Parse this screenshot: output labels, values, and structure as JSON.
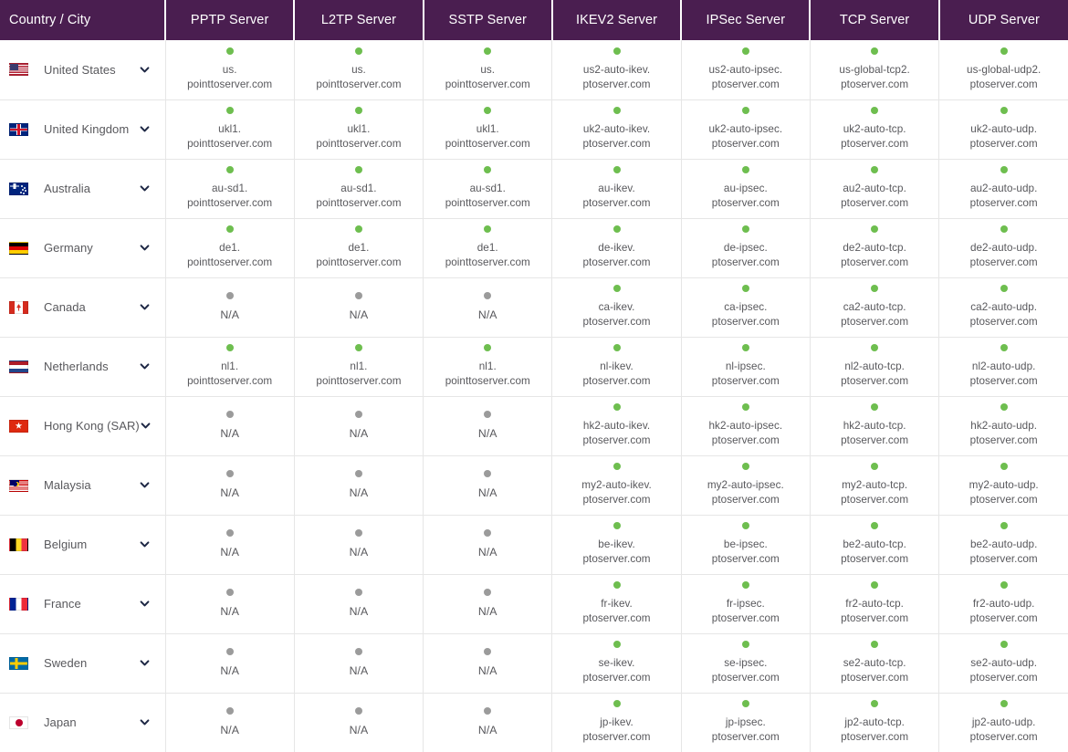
{
  "table": {
    "columns": [
      {
        "key": "country",
        "label": "Country / City"
      },
      {
        "key": "pptp",
        "label": "PPTP Server"
      },
      {
        "key": "l2tp",
        "label": "L2TP Server"
      },
      {
        "key": "sstp",
        "label": "SSTP Server"
      },
      {
        "key": "ikev2",
        "label": "IKEV2 Server"
      },
      {
        "key": "ipsec",
        "label": "IPSec Server"
      },
      {
        "key": "tcp",
        "label": "TCP Server"
      },
      {
        "key": "udp",
        "label": "UDP Server"
      }
    ],
    "na_label": "N/A",
    "expand_icon": "chevron-down-icon",
    "colors": {
      "header_bg": "#4A1E50",
      "header_text": "#ffffff",
      "status_online": "#6EBE4F",
      "status_offline": "#9b9b9b",
      "cell_text": "#58585c",
      "row_border": "#e6e6e6",
      "page_bg": "#ffffff"
    },
    "rows": [
      {
        "country": "United States",
        "flag": "flag-united-states",
        "cells": [
          {
            "status": "online",
            "line1": "us.",
            "line2": "pointtoserver.com"
          },
          {
            "status": "online",
            "line1": "us.",
            "line2": "pointtoserver.com"
          },
          {
            "status": "online",
            "line1": "us.",
            "line2": "pointtoserver.com"
          },
          {
            "status": "online",
            "line1": "us2-auto-ikev.",
            "line2": "ptoserver.com"
          },
          {
            "status": "online",
            "line1": "us2-auto-ipsec.",
            "line2": "ptoserver.com"
          },
          {
            "status": "online",
            "line1": "us-global-tcp2.",
            "line2": "ptoserver.com"
          },
          {
            "status": "online",
            "line1": "us-global-udp2.",
            "line2": "ptoserver.com"
          }
        ]
      },
      {
        "country": "United Kingdom",
        "flag": "flag-united-kingdom",
        "cells": [
          {
            "status": "online",
            "line1": "ukl1.",
            "line2": "pointtoserver.com"
          },
          {
            "status": "online",
            "line1": "ukl1.",
            "line2": "pointtoserver.com"
          },
          {
            "status": "online",
            "line1": "ukl1.",
            "line2": "pointtoserver.com"
          },
          {
            "status": "online",
            "line1": "uk2-auto-ikev.",
            "line2": "ptoserver.com"
          },
          {
            "status": "online",
            "line1": "uk2-auto-ipsec.",
            "line2": "ptoserver.com"
          },
          {
            "status": "online",
            "line1": "uk2-auto-tcp.",
            "line2": "ptoserver.com"
          },
          {
            "status": "online",
            "line1": "uk2-auto-udp.",
            "line2": "ptoserver.com"
          }
        ]
      },
      {
        "country": "Australia",
        "flag": "flag-australia",
        "cells": [
          {
            "status": "online",
            "line1": "au-sd1.",
            "line2": "pointtoserver.com"
          },
          {
            "status": "online",
            "line1": "au-sd1.",
            "line2": "pointtoserver.com"
          },
          {
            "status": "online",
            "line1": "au-sd1.",
            "line2": "pointtoserver.com"
          },
          {
            "status": "online",
            "line1": "au-ikev.",
            "line2": "ptoserver.com"
          },
          {
            "status": "online",
            "line1": "au-ipsec.",
            "line2": "ptoserver.com"
          },
          {
            "status": "online",
            "line1": "au2-auto-tcp.",
            "line2": "ptoserver.com"
          },
          {
            "status": "online",
            "line1": "au2-auto-udp.",
            "line2": "ptoserver.com"
          }
        ]
      },
      {
        "country": "Germany",
        "flag": "flag-germany",
        "cells": [
          {
            "status": "online",
            "line1": "de1.",
            "line2": "pointtoserver.com"
          },
          {
            "status": "online",
            "line1": "de1.",
            "line2": "pointtoserver.com"
          },
          {
            "status": "online",
            "line1": "de1.",
            "line2": "pointtoserver.com"
          },
          {
            "status": "online",
            "line1": "de-ikev.",
            "line2": "ptoserver.com"
          },
          {
            "status": "online",
            "line1": "de-ipsec.",
            "line2": "ptoserver.com"
          },
          {
            "status": "online",
            "line1": "de2-auto-tcp.",
            "line2": "ptoserver.com"
          },
          {
            "status": "online",
            "line1": "de2-auto-udp.",
            "line2": "ptoserver.com"
          }
        ]
      },
      {
        "country": "Canada",
        "flag": "flag-canada",
        "cells": [
          {
            "status": "offline",
            "line1": "N/A",
            "line2": ""
          },
          {
            "status": "offline",
            "line1": "N/A",
            "line2": ""
          },
          {
            "status": "offline",
            "line1": "N/A",
            "line2": ""
          },
          {
            "status": "online",
            "line1": "ca-ikev.",
            "line2": "ptoserver.com"
          },
          {
            "status": "online",
            "line1": "ca-ipsec.",
            "line2": "ptoserver.com"
          },
          {
            "status": "online",
            "line1": "ca2-auto-tcp.",
            "line2": "ptoserver.com"
          },
          {
            "status": "online",
            "line1": "ca2-auto-udp.",
            "line2": "ptoserver.com"
          }
        ]
      },
      {
        "country": "Netherlands",
        "flag": "flag-netherlands",
        "cells": [
          {
            "status": "online",
            "line1": "nl1.",
            "line2": "pointtoserver.com"
          },
          {
            "status": "online",
            "line1": "nl1.",
            "line2": "pointtoserver.com"
          },
          {
            "status": "online",
            "line1": "nl1.",
            "line2": "pointtoserver.com"
          },
          {
            "status": "online",
            "line1": "nl-ikev.",
            "line2": "ptoserver.com"
          },
          {
            "status": "online",
            "line1": "nl-ipsec.",
            "line2": "ptoserver.com"
          },
          {
            "status": "online",
            "line1": "nl2-auto-tcp.",
            "line2": "ptoserver.com"
          },
          {
            "status": "online",
            "line1": "nl2-auto-udp.",
            "line2": "ptoserver.com"
          }
        ]
      },
      {
        "country": "Hong Kong (SAR)",
        "flag": "flag-hong-kong",
        "cells": [
          {
            "status": "offline",
            "line1": "N/A",
            "line2": ""
          },
          {
            "status": "offline",
            "line1": "N/A",
            "line2": ""
          },
          {
            "status": "offline",
            "line1": "N/A",
            "line2": ""
          },
          {
            "status": "online",
            "line1": "hk2-auto-ikev.",
            "line2": "ptoserver.com"
          },
          {
            "status": "online",
            "line1": "hk2-auto-ipsec.",
            "line2": "ptoserver.com"
          },
          {
            "status": "online",
            "line1": "hk2-auto-tcp.",
            "line2": "ptoserver.com"
          },
          {
            "status": "online",
            "line1": "hk2-auto-udp.",
            "line2": "ptoserver.com"
          }
        ]
      },
      {
        "country": "Malaysia",
        "flag": "flag-malaysia",
        "cells": [
          {
            "status": "offline",
            "line1": "N/A",
            "line2": ""
          },
          {
            "status": "offline",
            "line1": "N/A",
            "line2": ""
          },
          {
            "status": "offline",
            "line1": "N/A",
            "line2": ""
          },
          {
            "status": "online",
            "line1": "my2-auto-ikev.",
            "line2": "ptoserver.com"
          },
          {
            "status": "online",
            "line1": "my2-auto-ipsec.",
            "line2": "ptoserver.com"
          },
          {
            "status": "online",
            "line1": "my2-auto-tcp.",
            "line2": "ptoserver.com"
          },
          {
            "status": "online",
            "line1": "my2-auto-udp.",
            "line2": "ptoserver.com"
          }
        ]
      },
      {
        "country": "Belgium",
        "flag": "flag-belgium",
        "cells": [
          {
            "status": "offline",
            "line1": "N/A",
            "line2": ""
          },
          {
            "status": "offline",
            "line1": "N/A",
            "line2": ""
          },
          {
            "status": "offline",
            "line1": "N/A",
            "line2": ""
          },
          {
            "status": "online",
            "line1": "be-ikev.",
            "line2": "ptoserver.com"
          },
          {
            "status": "online",
            "line1": "be-ipsec.",
            "line2": "ptoserver.com"
          },
          {
            "status": "online",
            "line1": "be2-auto-tcp.",
            "line2": "ptoserver.com"
          },
          {
            "status": "online",
            "line1": "be2-auto-udp.",
            "line2": "ptoserver.com"
          }
        ]
      },
      {
        "country": "France",
        "flag": "flag-france",
        "cells": [
          {
            "status": "offline",
            "line1": "N/A",
            "line2": ""
          },
          {
            "status": "offline",
            "line1": "N/A",
            "line2": ""
          },
          {
            "status": "offline",
            "line1": "N/A",
            "line2": ""
          },
          {
            "status": "online",
            "line1": "fr-ikev.",
            "line2": "ptoserver.com"
          },
          {
            "status": "online",
            "line1": "fr-ipsec.",
            "line2": "ptoserver.com"
          },
          {
            "status": "online",
            "line1": "fr2-auto-tcp.",
            "line2": "ptoserver.com"
          },
          {
            "status": "online",
            "line1": "fr2-auto-udp.",
            "line2": "ptoserver.com"
          }
        ]
      },
      {
        "country": "Sweden",
        "flag": "flag-sweden",
        "cells": [
          {
            "status": "offline",
            "line1": "N/A",
            "line2": ""
          },
          {
            "status": "offline",
            "line1": "N/A",
            "line2": ""
          },
          {
            "status": "offline",
            "line1": "N/A",
            "line2": ""
          },
          {
            "status": "online",
            "line1": "se-ikev.",
            "line2": "ptoserver.com"
          },
          {
            "status": "online",
            "line1": "se-ipsec.",
            "line2": "ptoserver.com"
          },
          {
            "status": "online",
            "line1": "se2-auto-tcp.",
            "line2": "ptoserver.com"
          },
          {
            "status": "online",
            "line1": "se2-auto-udp.",
            "line2": "ptoserver.com"
          }
        ]
      },
      {
        "country": "Japan",
        "flag": "flag-japan",
        "cells": [
          {
            "status": "offline",
            "line1": "N/A",
            "line2": ""
          },
          {
            "status": "offline",
            "line1": "N/A",
            "line2": ""
          },
          {
            "status": "offline",
            "line1": "N/A",
            "line2": ""
          },
          {
            "status": "online",
            "line1": "jp-ikev.",
            "line2": "ptoserver.com"
          },
          {
            "status": "online",
            "line1": "jp-ipsec.",
            "line2": "ptoserver.com"
          },
          {
            "status": "online",
            "line1": "jp2-auto-tcp.",
            "line2": "ptoserver.com"
          },
          {
            "status": "online",
            "line1": "jp2-auto-udp.",
            "line2": "ptoserver.com"
          }
        ]
      }
    ]
  }
}
